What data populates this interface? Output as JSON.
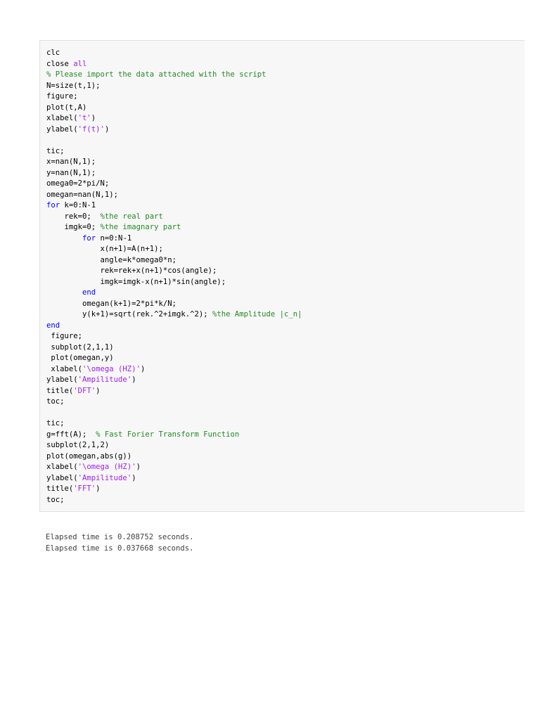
{
  "colors": {
    "code_background": "#f7f7f7",
    "code_text": "#000000",
    "keyword": "#0000ff",
    "string": "#a020f0",
    "comment": "#228b22",
    "output_text": "#404040"
  },
  "code_lines": [
    [
      {
        "t": "code",
        "s": "clc"
      }
    ],
    [
      {
        "t": "code",
        "s": "close "
      },
      {
        "t": "str",
        "s": "all"
      }
    ],
    [
      {
        "t": "cmt",
        "s": "% Please import the data attached with the script"
      }
    ],
    [
      {
        "t": "code",
        "s": "N=size(t,1);"
      }
    ],
    [
      {
        "t": "code",
        "s": "figure;"
      }
    ],
    [
      {
        "t": "code",
        "s": "plot(t,A)"
      }
    ],
    [
      {
        "t": "code",
        "s": "xlabel("
      },
      {
        "t": "str",
        "s": "'t'"
      },
      {
        "t": "code",
        "s": ")"
      }
    ],
    [
      {
        "t": "code",
        "s": "ylabel("
      },
      {
        "t": "str",
        "s": "'f(t)'"
      },
      {
        "t": "code",
        "s": ")"
      }
    ],
    [],
    [
      {
        "t": "code",
        "s": "tic;"
      }
    ],
    [
      {
        "t": "code",
        "s": "x=nan(N,1);"
      }
    ],
    [
      {
        "t": "code",
        "s": "y=nan(N,1);"
      }
    ],
    [
      {
        "t": "code",
        "s": "omega0=2*pi/N;"
      }
    ],
    [
      {
        "t": "code",
        "s": "omegan=nan(N,1);"
      }
    ],
    [
      {
        "t": "kw",
        "s": "for"
      },
      {
        "t": "code",
        "s": " k=0:N-1"
      }
    ],
    [
      {
        "t": "code",
        "s": "    rek=0;  "
      },
      {
        "t": "cmt",
        "s": "%the real part"
      }
    ],
    [
      {
        "t": "code",
        "s": "    imgk=0; "
      },
      {
        "t": "cmt",
        "s": "%the imagnary part"
      }
    ],
    [
      {
        "t": "code",
        "s": "        "
      },
      {
        "t": "kw",
        "s": "for"
      },
      {
        "t": "code",
        "s": " n=0:N-1"
      }
    ],
    [
      {
        "t": "code",
        "s": "            x(n+1)=A(n+1);"
      }
    ],
    [
      {
        "t": "code",
        "s": "            angle=k*omega0*n;"
      }
    ],
    [
      {
        "t": "code",
        "s": "            rek=rek+x(n+1)*cos(angle);"
      }
    ],
    [
      {
        "t": "code",
        "s": "            imgk=imgk-x(n+1)*sin(angle);"
      }
    ],
    [
      {
        "t": "code",
        "s": "        "
      },
      {
        "t": "kw",
        "s": "end"
      }
    ],
    [
      {
        "t": "code",
        "s": "        omegan(k+1)=2*pi*k/N;"
      }
    ],
    [
      {
        "t": "code",
        "s": "        y(k+1)=sqrt(rek.^2+imgk.^2); "
      },
      {
        "t": "cmt",
        "s": "%the Amplitude |c_n|"
      }
    ],
    [
      {
        "t": "kw",
        "s": "end"
      }
    ],
    [
      {
        "t": "code",
        "s": " figure;"
      }
    ],
    [
      {
        "t": "code",
        "s": " subplot(2,1,1)"
      }
    ],
    [
      {
        "t": "code",
        "s": " plot(omegan,y)"
      }
    ],
    [
      {
        "t": "code",
        "s": " xlabel("
      },
      {
        "t": "str",
        "s": "'\\omega (HZ)'"
      },
      {
        "t": "code",
        "s": ")"
      }
    ],
    [
      {
        "t": "code",
        "s": "ylabel("
      },
      {
        "t": "str",
        "s": "'Ampilitude'"
      },
      {
        "t": "code",
        "s": ")"
      }
    ],
    [
      {
        "t": "code",
        "s": "title("
      },
      {
        "t": "str",
        "s": "'DFT'"
      },
      {
        "t": "code",
        "s": ")"
      }
    ],
    [
      {
        "t": "code",
        "s": "toc;"
      }
    ],
    [],
    [
      {
        "t": "code",
        "s": "tic;"
      }
    ],
    [
      {
        "t": "code",
        "s": "g=fft(A);  "
      },
      {
        "t": "cmt",
        "s": "% Fast Forier Transform Function"
      }
    ],
    [
      {
        "t": "code",
        "s": "subplot(2,1,2)"
      }
    ],
    [
      {
        "t": "code",
        "s": "plot(omegan,abs(g))"
      }
    ],
    [
      {
        "t": "code",
        "s": "xlabel("
      },
      {
        "t": "str",
        "s": "'\\omega (HZ)'"
      },
      {
        "t": "code",
        "s": ")"
      }
    ],
    [
      {
        "t": "code",
        "s": "ylabel("
      },
      {
        "t": "str",
        "s": "'Ampilitude'"
      },
      {
        "t": "code",
        "s": ")"
      }
    ],
    [
      {
        "t": "code",
        "s": "title("
      },
      {
        "t": "str",
        "s": "'FFT'"
      },
      {
        "t": "code",
        "s": ")"
      }
    ],
    [
      {
        "t": "code",
        "s": "toc;"
      }
    ]
  ],
  "output_lines": [
    "Elapsed time is 0.208752 seconds.",
    "Elapsed time is 0.037668 seconds."
  ]
}
